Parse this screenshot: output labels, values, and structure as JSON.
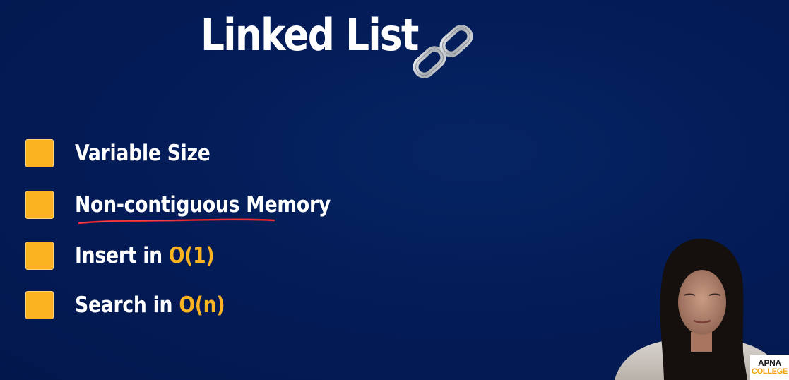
{
  "slide": {
    "title": "Linked List",
    "title_icon": "chain-link-icon",
    "background_color": "#031b56",
    "accent_color": "#fbb322",
    "annotation_color": "#e0202a"
  },
  "bullets": [
    {
      "icon": "checkbox-icon",
      "text": "Variable Size",
      "highlight": ""
    },
    {
      "icon": "checkbox-icon",
      "text": "Non-contiguous Memory",
      "highlight": ""
    },
    {
      "icon": "checkbox-icon",
      "text": "Insert in ",
      "highlight": "O(1)"
    },
    {
      "icon": "checkbox-icon",
      "text": "Search in ",
      "highlight": "O(n)"
    }
  ],
  "logo": {
    "line1": "APNA",
    "line2": "COLLEGE"
  }
}
